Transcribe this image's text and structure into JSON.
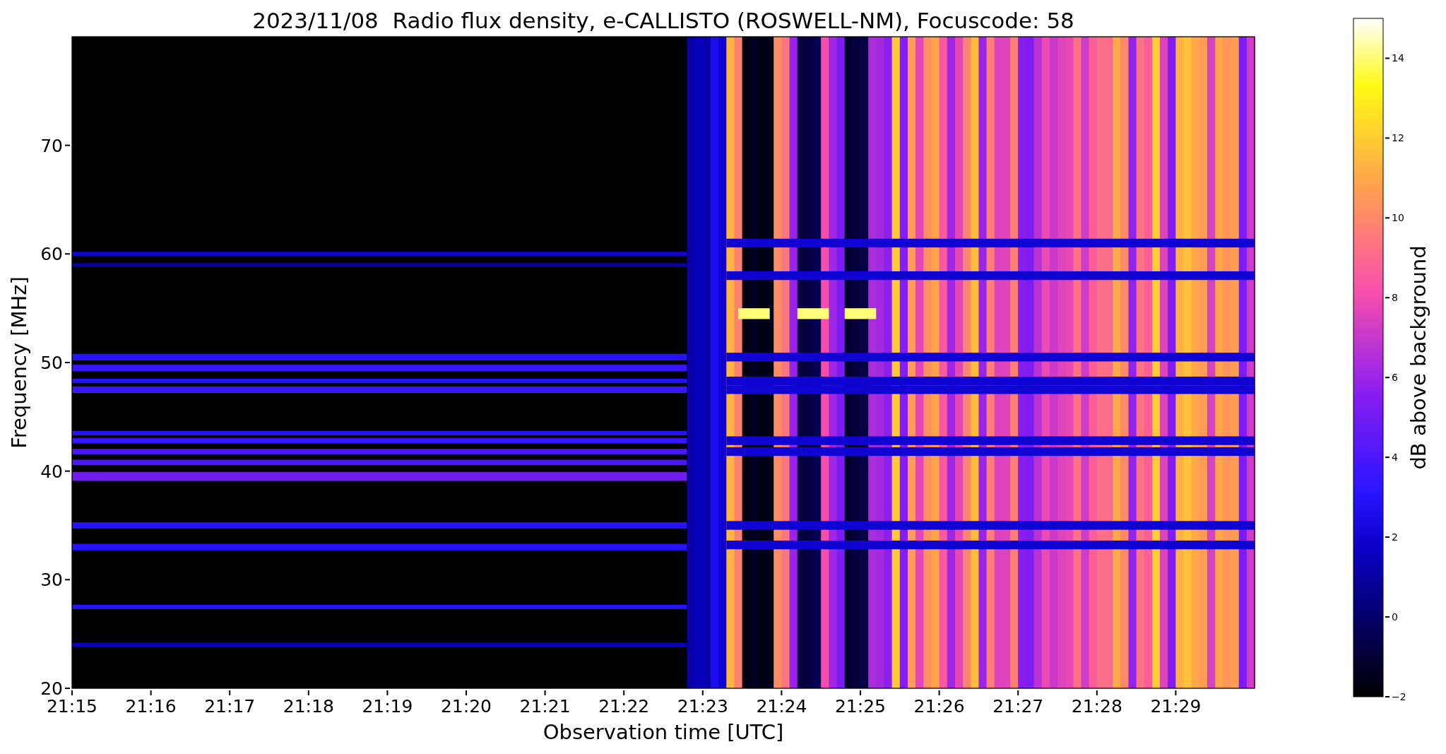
{
  "chart": {
    "title": "2023/11/08  Radio flux density, e-CALLISTO (ROSWELL-NM), Focuscode: 58",
    "ylabel": "Frequency [MHz]",
    "xlabel": "Observation time [UTC]",
    "yticks": [
      "70",
      "60",
      "50",
      "40",
      "30",
      "20"
    ],
    "xticks": [
      "21:15",
      "21:16",
      "21:17",
      "21:18",
      "21:19",
      "21:20",
      "21:21",
      "21:22",
      "21:23",
      "21:24",
      "21:25",
      "21:26",
      "21:27",
      "21:28",
      "21:29"
    ]
  },
  "colorbar": {
    "label": "dB above background",
    "ticks": [
      "14",
      "12",
      "10",
      "8",
      "6",
      "4",
      "2",
      "0",
      "−2"
    ]
  }
}
